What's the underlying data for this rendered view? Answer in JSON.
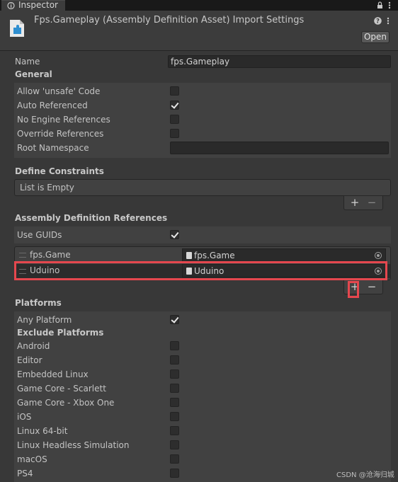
{
  "tab": {
    "label": "Inspector"
  },
  "header": {
    "title": "Fps.Gameplay (Assembly Definition Asset) Import Settings",
    "open_label": "Open",
    "help_icon": "?"
  },
  "name_field": {
    "label": "Name",
    "value": "fps.Gameplay"
  },
  "general": {
    "heading": "General",
    "allow_unsafe": {
      "label": "Allow 'unsafe' Code",
      "checked": false
    },
    "auto_referenced": {
      "label": "Auto Referenced",
      "checked": true
    },
    "no_engine_refs": {
      "label": "No Engine References",
      "checked": false
    },
    "override_refs": {
      "label": "Override References",
      "checked": false
    },
    "root_namespace": {
      "label": "Root Namespace",
      "value": ""
    }
  },
  "define_constraints": {
    "heading": "Define Constraints",
    "empty_text": "List is Empty",
    "add": "+",
    "remove": "−"
  },
  "assembly_refs": {
    "heading": "Assembly Definition References",
    "use_guids": {
      "label": "Use GUIDs",
      "checked": true
    },
    "items": [
      {
        "name": "fps.Game",
        "value": "fps.Game"
      },
      {
        "name": "Uduino",
        "value": "Uduino"
      }
    ],
    "add": "+",
    "remove": "−"
  },
  "platforms": {
    "heading": "Platforms",
    "any_platform": {
      "label": "Any Platform",
      "checked": true
    },
    "exclude_heading": "Exclude Platforms",
    "list": [
      "Android",
      "Editor",
      "Embedded Linux",
      "Game Core - Scarlett",
      "Game Core - Xbox One",
      "iOS",
      "Linux 64-bit",
      "Linux Headless Simulation",
      "macOS",
      "PS4"
    ]
  },
  "watermark": "CSDN @沧海归城",
  "colors": {
    "highlight": "#e5474e",
    "background": "#383838",
    "panel": "#414141"
  }
}
